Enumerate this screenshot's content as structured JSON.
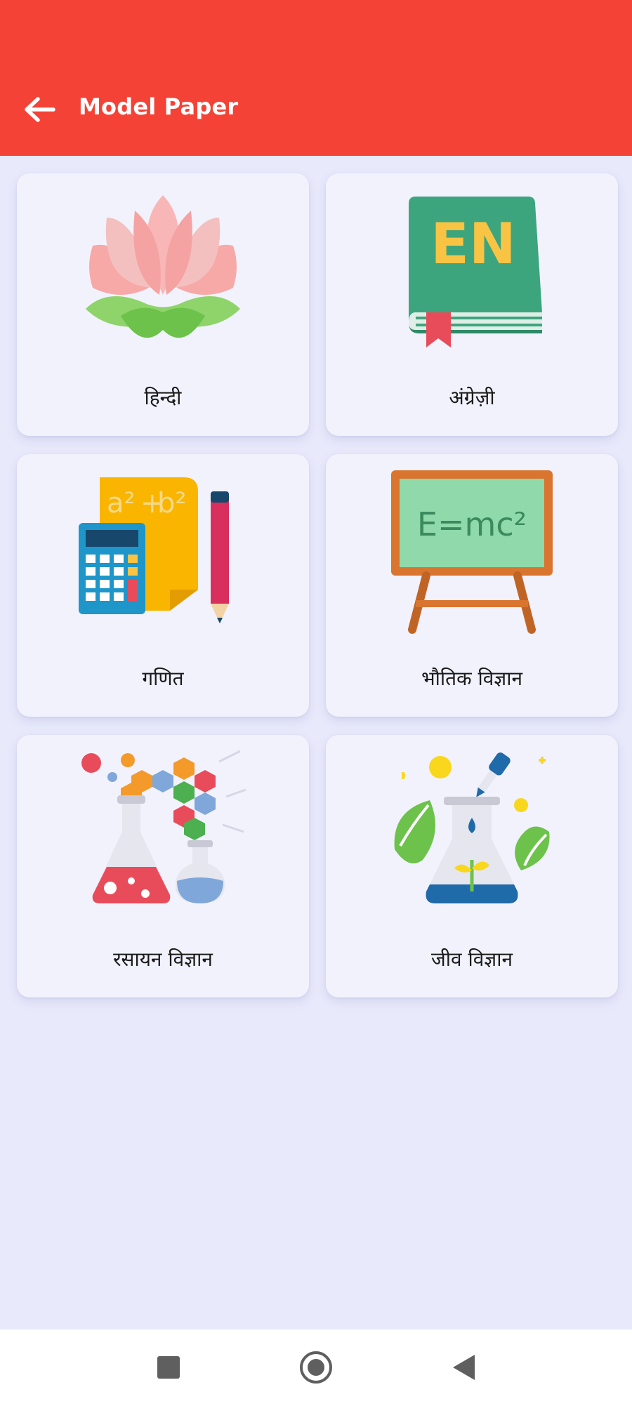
{
  "header": {
    "title": "Model Paper",
    "back_icon": "arrow-left-icon"
  },
  "colors": {
    "appbar": "#f44336",
    "background": "#e8e9fb",
    "card": "#f2f2fd"
  },
  "subjects": [
    {
      "label": "हिन्दी",
      "icon": "lotus-icon"
    },
    {
      "label": "अंग्रेज़ी",
      "icon": "english-book-icon"
    },
    {
      "label": "गणित",
      "icon": "calculator-math-icon"
    },
    {
      "label": "भौतिक विज्ञान",
      "icon": "blackboard-formula-icon"
    },
    {
      "label": "रसायन विज्ञान",
      "icon": "chemistry-flask-icon"
    },
    {
      "label": "जीव विज्ञान",
      "icon": "biology-flask-leaves-icon"
    }
  ],
  "icon_text": {
    "english_book": "EN",
    "formula": "E=mc²",
    "math_a": "a²",
    "math_plus": "+",
    "math_b": "b²"
  },
  "navbar": {
    "icons": [
      "recent-apps-icon",
      "home-icon",
      "back-triangle-icon"
    ]
  }
}
